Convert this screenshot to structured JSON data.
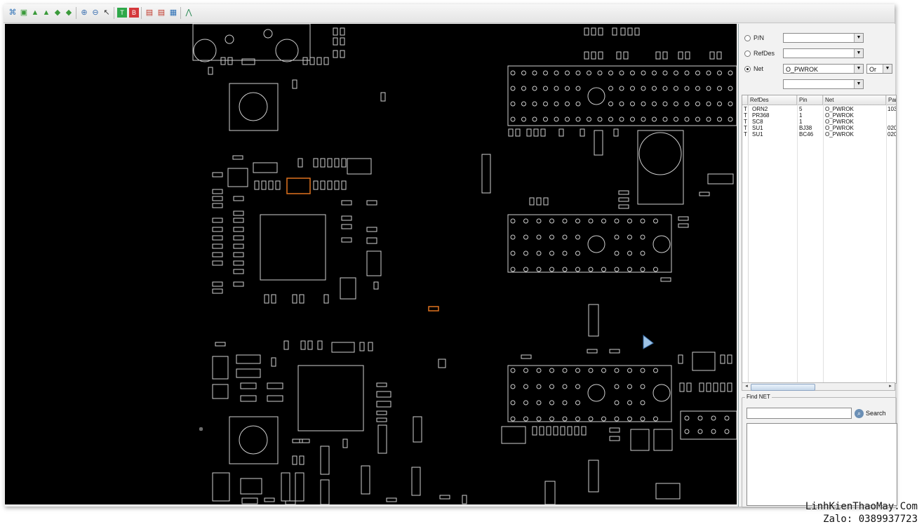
{
  "toolbar": {
    "icons": [
      "fit-icon",
      "select-icon",
      "flip-top-icon",
      "flip-bottom-icon",
      "rotate-left-icon",
      "rotate-right-icon",
      "zoom-in-icon",
      "zoom-out-icon",
      "pointer-icon",
      "top-layer-icon",
      "bottom-layer-icon",
      "show-parts-icon",
      "show-pins-icon",
      "save-icon",
      "net-highlight-icon"
    ]
  },
  "panel": {
    "search_modes": [
      {
        "label": "P/N",
        "selected": false,
        "value": ""
      },
      {
        "label": "RefDes",
        "selected": false,
        "value": ""
      },
      {
        "label": "Net",
        "selected": true,
        "value": "O_PWROK"
      }
    ],
    "operator": "Or",
    "extra_value": "",
    "grid": {
      "columns": [
        "RefDes",
        "Pin",
        "Net",
        "Par"
      ],
      "rows": [
        {
          "side": "T",
          "refdes": "ORN2",
          "pin": "5",
          "net": "O_PWROK",
          "part": "103"
        },
        {
          "side": "T",
          "refdes": "PR368",
          "pin": "1",
          "net": "O_PWROK",
          "part": ""
        },
        {
          "side": "T",
          "refdes": "SC8",
          "pin": "1",
          "net": "O_PWROK",
          "part": ""
        },
        {
          "side": "T",
          "refdes": "SU1",
          "pin": "BJ38",
          "net": "O_PWROK",
          "part": "020"
        },
        {
          "side": "T",
          "refdes": "SU1",
          "pin": "BC46",
          "net": "O_PWROK",
          "part": "020"
        }
      ]
    },
    "find_net": {
      "label": "Find NET",
      "input_value": "",
      "search_label": "Search"
    }
  },
  "colors": {
    "canvas_bg": "#000000",
    "outline": "#cfcfcf",
    "highlight": "#e0731f"
  },
  "watermark": {
    "line1": "LinhKienThaoMay.Com",
    "line2": "Zalo: 0389937723"
  }
}
